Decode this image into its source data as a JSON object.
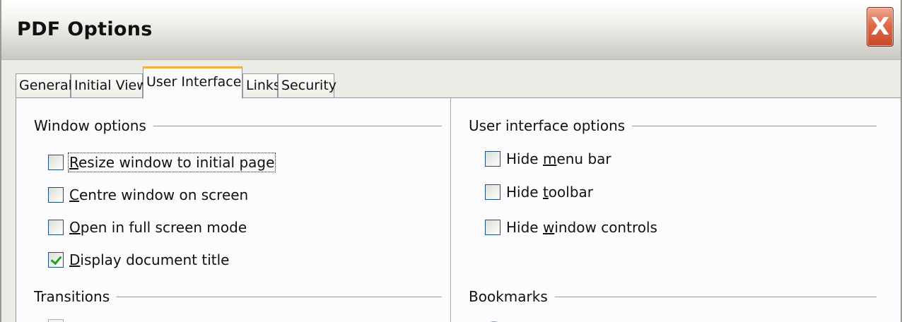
{
  "window": {
    "title": "PDF Options",
    "close_glyph": "X"
  },
  "tabs": [
    {
      "label": "General"
    },
    {
      "label": "Initial View"
    },
    {
      "label": "User Interface"
    },
    {
      "label": "Links"
    },
    {
      "label": "Security"
    }
  ],
  "active_tab": "User Interface",
  "window_options": {
    "title": "Window options",
    "items": [
      {
        "label_pre": "",
        "accesskey": "R",
        "label_post": "esize window to initial page",
        "checked": false
      },
      {
        "label_pre": "",
        "accesskey": "C",
        "label_post": "entre window on screen",
        "checked": false
      },
      {
        "label_pre": "",
        "accesskey": "O",
        "label_post": "pen in full screen mode",
        "checked": false
      },
      {
        "label_pre": "",
        "accesskey": "D",
        "label_post": "isplay document title",
        "checked": true
      }
    ]
  },
  "ui_options": {
    "title": "User interface options",
    "items": [
      {
        "label_pre": "Hide ",
        "accesskey": "m",
        "label_post": "enu bar",
        "checked": false
      },
      {
        "label_pre": "Hide ",
        "accesskey": "t",
        "label_post": "oolbar",
        "checked": false
      },
      {
        "label_pre": "Hide ",
        "accesskey": "w",
        "label_post": "indow controls",
        "checked": false
      }
    ]
  },
  "transitions": {
    "title": "Transitions"
  },
  "bookmarks": {
    "title": "Bookmarks"
  },
  "colors": {
    "tab_highlight": "#f5b03c",
    "checkmark": "#21a121",
    "close_button": "#e06a48"
  }
}
